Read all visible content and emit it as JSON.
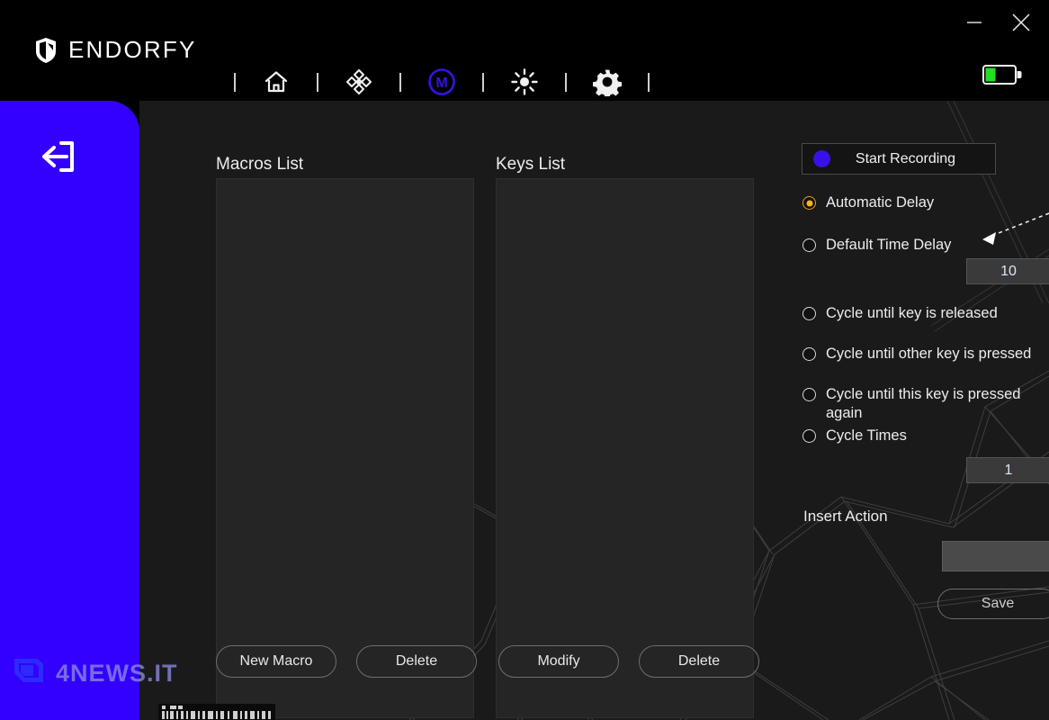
{
  "window": {
    "app_name": "ENDORFY",
    "minimize_label": "–",
    "close_label": "×",
    "battery_icon": "battery-icon",
    "battery_level_percent": 35,
    "battery_fill_color": "#22dd22"
  },
  "toolbar": {
    "items": [
      {
        "icon": "home-icon",
        "name": "home",
        "active": false
      },
      {
        "icon": "dpi-target-icon",
        "name": "performance",
        "active": false
      },
      {
        "icon": "macro-m-icon",
        "name": "macro",
        "active": true
      },
      {
        "icon": "brightness-icon",
        "name": "lighting",
        "active": false
      },
      {
        "icon": "gear-icon",
        "name": "settings",
        "active": false
      }
    ],
    "active_color": "#3a10e8",
    "inactive_color": "#f0f0f0"
  },
  "sidebar": {
    "back_icon": "back-exit-arrow-icon",
    "background_color": "#3300ff"
  },
  "watermark": {
    "text": "4NEWS.IT",
    "logo_icon": "4news-logo-icon"
  },
  "main": {
    "macros": {
      "title": "Macros List",
      "items": []
    },
    "keys": {
      "title": "Keys List",
      "items": []
    },
    "buttons": {
      "new_macro": "New Macro",
      "delete_macro": "Delete",
      "modify_key": "Modify",
      "delete_key": "Delete"
    }
  },
  "right_panel": {
    "record": {
      "label": "Start Recording",
      "dot_color": "#3a10e8"
    },
    "delay_options": [
      {
        "label": "Automatic  Delay",
        "selected": true
      },
      {
        "label": "Default Time Delay",
        "selected": false
      }
    ],
    "default_time_delay_value": "10",
    "cycle_options": [
      {
        "label": "Cycle until key is released",
        "selected": false
      },
      {
        "label": "Cycle until other key is pressed",
        "selected": false
      },
      {
        "label": "Cycle until this key is pressed again",
        "selected": false
      },
      {
        "label": "Cycle Times",
        "selected": false
      }
    ],
    "cycle_times_value": "1",
    "insert_action": {
      "label": "Insert Action",
      "selected_value": "",
      "chevron_icon": "chevron-down-icon"
    },
    "save_label": "Save",
    "selected_radio_color": "#ffb319"
  }
}
